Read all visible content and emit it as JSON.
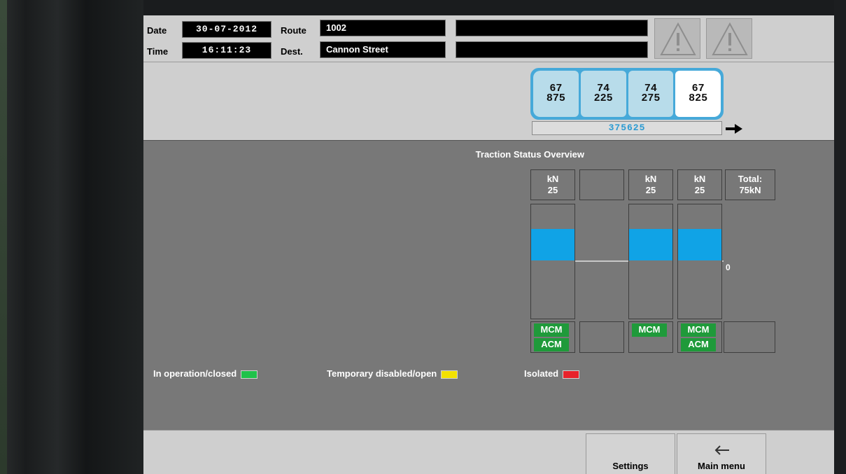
{
  "header": {
    "date_label": "Date",
    "date_value": "30-07-2012",
    "time_label": "Time",
    "time_value": "16:11:23",
    "route_label": "Route",
    "route_value": "1002",
    "dest_label": "Dest.",
    "dest_value": "Cannon Street",
    "message_1": "",
    "message_2": ""
  },
  "train": {
    "cars": [
      {
        "top": "67",
        "bottom": "875",
        "active": false
      },
      {
        "top": "74",
        "bottom": "225",
        "active": false
      },
      {
        "top": "74",
        "bottom": "275",
        "active": false
      },
      {
        "top": "67",
        "bottom": "825",
        "active": true
      }
    ],
    "unit_number": "375625"
  },
  "traction": {
    "title": "Traction Status Overview",
    "columns": [
      {
        "unit": "kN",
        "value": "25",
        "mcm": "MCM",
        "acm": "ACM",
        "has_bar": true
      },
      {
        "unit": "",
        "value": "",
        "mcm": "",
        "acm": "",
        "has_bar": false
      },
      {
        "unit": "kN",
        "value": "25",
        "mcm": "MCM",
        "acm": "",
        "has_bar": true
      },
      {
        "unit": "kN",
        "value": "25",
        "mcm": "MCM",
        "acm": "ACM",
        "has_bar": true
      }
    ],
    "total_label": "Total:",
    "total_value": "75kN",
    "zero_label": "0"
  },
  "legend": {
    "in_operation": "In operation/closed",
    "temporary": "Temporary disabled/open",
    "isolated": "Isolated",
    "colors": {
      "in_operation": "#1fc24a",
      "temporary": "#f3e100",
      "isolated": "#e8222a"
    }
  },
  "nav": {
    "settings": "Settings",
    "main_menu": "Main menu"
  }
}
